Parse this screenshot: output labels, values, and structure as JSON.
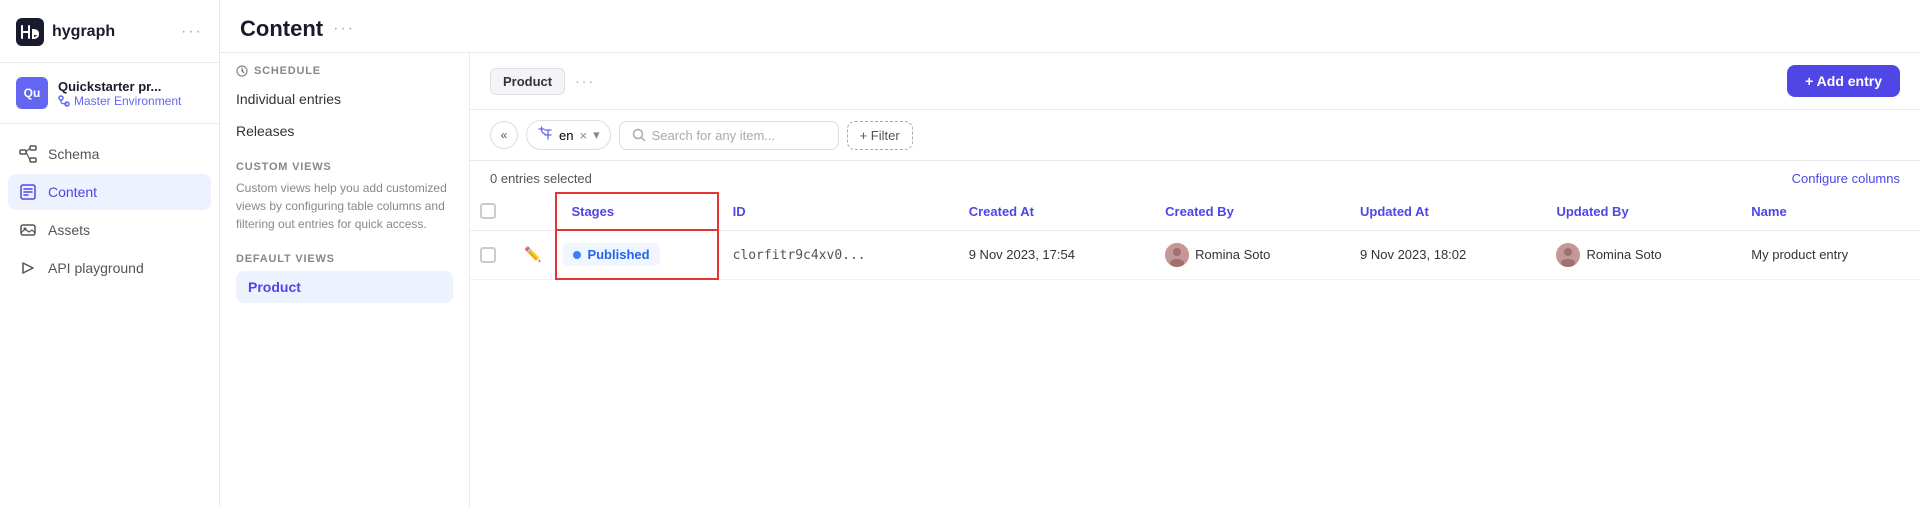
{
  "app": {
    "logo_text": "hygraph",
    "logo_dots": "···",
    "title_dots": "···"
  },
  "workspace": {
    "avatar": "Qu",
    "name": "Quickstarter pr...",
    "env": "Master Environment"
  },
  "nav": {
    "items": [
      {
        "id": "schema",
        "label": "Schema"
      },
      {
        "id": "content",
        "label": "Content"
      },
      {
        "id": "assets",
        "label": "Assets"
      },
      {
        "id": "api-playground",
        "label": "API playground"
      }
    ]
  },
  "content_panel": {
    "title": "Content",
    "schedule_header": "SCHEDULE",
    "individual_entries": "Individual entries",
    "releases": "Releases",
    "custom_views_header": "CUSTOM VIEWS",
    "custom_views_desc": "Custom views help you add customized views by configuring table columns and filtering out entries for quick access.",
    "default_views_header": "DEFAULT VIEWS",
    "default_view_product": "Product"
  },
  "top_bar": {
    "product_tab": "Product",
    "tab_dots": "···",
    "add_entry": "+ Add entry"
  },
  "toolbar": {
    "collapse_icon": "«",
    "lang_code": "en",
    "lang_x": "×",
    "lang_chevron": "▾",
    "search_placeholder": "Search for any item...",
    "filter_label": "+ Filter"
  },
  "table": {
    "entries_selected": "0 entries selected",
    "configure_columns": "Configure columns",
    "columns": [
      {
        "id": "stages",
        "label": "Stages"
      },
      {
        "id": "id",
        "label": "ID"
      },
      {
        "id": "created_at",
        "label": "Created At"
      },
      {
        "id": "created_by",
        "label": "Created By"
      },
      {
        "id": "updated_at",
        "label": "Updated At"
      },
      {
        "id": "updated_by",
        "label": "Updated By"
      },
      {
        "id": "name",
        "label": "Name"
      }
    ],
    "rows": [
      {
        "stage": "Published",
        "id": "clorfitr9c4xv0...",
        "created_at": "9 Nov 2023, 17:54",
        "created_by": "Romina Soto",
        "updated_at": "9 Nov 2023, 18:02",
        "updated_by": "Romina Soto",
        "name": "My product entry"
      }
    ]
  }
}
